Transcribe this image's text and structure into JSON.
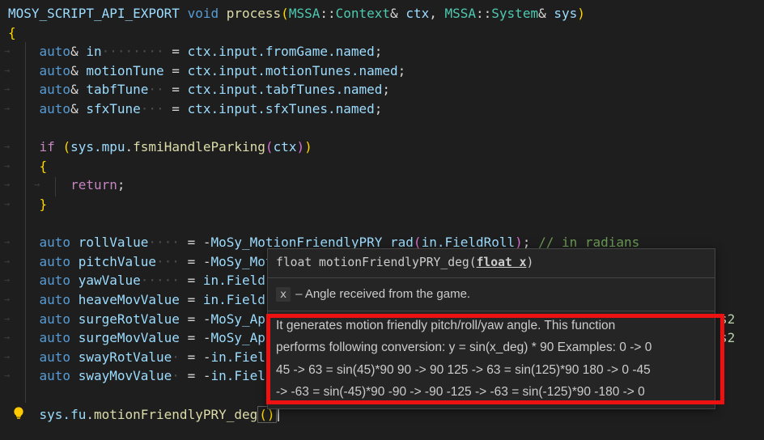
{
  "colors": {
    "editor_bg": "#1e1e1e",
    "keyword_blue": "#569cd6",
    "control_purple": "#c586c0",
    "variable_blue": "#9cdcfe",
    "function_yellow": "#dcdcaa",
    "type_teal": "#4ec9b0",
    "comment_green": "#6a9955",
    "bracket_gold": "#ffd700",
    "bracket_pink": "#da70d6",
    "annotation_red": "#ee1111",
    "lightbulb_yellow": "#ffcb00"
  },
  "editor": {
    "lines": [
      {
        "tokens": [
          [
            "v",
            "MOSY_SCRIPT_API_EXPORT"
          ],
          [
            "d",
            " "
          ],
          [
            "k",
            "void"
          ],
          [
            "d",
            " "
          ],
          [
            "f",
            "process"
          ],
          [
            "g",
            "("
          ],
          [
            "t",
            "MSSA"
          ],
          [
            "d",
            "::"
          ],
          [
            "t",
            "Context"
          ],
          [
            "d",
            "& "
          ],
          [
            "v",
            "ctx"
          ],
          [
            "d",
            ", "
          ],
          [
            "t",
            "MSSA"
          ],
          [
            "d",
            "::"
          ],
          [
            "t",
            "System"
          ],
          [
            "d",
            "& "
          ],
          [
            "v",
            "sys"
          ],
          [
            "g",
            ")"
          ]
        ]
      },
      {
        "tokens": [
          [
            "g",
            "{"
          ]
        ]
      },
      {
        "arrow": true,
        "tokens": [
          [
            "d",
            "    "
          ],
          [
            "k",
            "auto"
          ],
          [
            "d",
            "& "
          ],
          [
            "v",
            "in"
          ],
          [
            "w",
            "········"
          ],
          [
            "d",
            " = "
          ],
          [
            "v",
            "ctx.input.fromGame.named"
          ],
          [
            "d",
            ";"
          ]
        ]
      },
      {
        "arrow": true,
        "tokens": [
          [
            "d",
            "    "
          ],
          [
            "k",
            "auto"
          ],
          [
            "d",
            "& "
          ],
          [
            "v",
            "motionTune"
          ],
          [
            "d",
            " = "
          ],
          [
            "v",
            "ctx.input.motionTunes.named"
          ],
          [
            "d",
            ";"
          ]
        ]
      },
      {
        "arrow": true,
        "tokens": [
          [
            "d",
            "    "
          ],
          [
            "k",
            "auto"
          ],
          [
            "d",
            "& "
          ],
          [
            "v",
            "tabfTune"
          ],
          [
            "w",
            "··"
          ],
          [
            "d",
            " = "
          ],
          [
            "v",
            "ctx.input.tabfTunes.named"
          ],
          [
            "d",
            ";"
          ]
        ]
      },
      {
        "arrow": true,
        "tokens": [
          [
            "d",
            "    "
          ],
          [
            "k",
            "auto"
          ],
          [
            "d",
            "& "
          ],
          [
            "v",
            "sfxTune"
          ],
          [
            "w",
            "···"
          ],
          [
            "d",
            " = "
          ],
          [
            "v",
            "ctx.input.sfxTunes.named"
          ],
          [
            "d",
            ";"
          ]
        ]
      },
      {
        "tokens": []
      },
      {
        "arrow": true,
        "tokens": [
          [
            "d",
            "    "
          ],
          [
            "c",
            "if"
          ],
          [
            "d",
            " "
          ],
          [
            "g",
            "("
          ],
          [
            "v",
            "sys.mpu"
          ],
          [
            "d",
            "."
          ],
          [
            "f",
            "fsmiHandleParking"
          ],
          [
            "p",
            "("
          ],
          [
            "v",
            "ctx"
          ],
          [
            "p",
            ")"
          ],
          [
            "g",
            ")"
          ]
        ]
      },
      {
        "arrow": true,
        "tokens": [
          [
            "d",
            "    "
          ],
          [
            "g",
            "{"
          ]
        ]
      },
      {
        "arrow": true,
        "arrow2": true,
        "tokens": [
          [
            "d",
            "        "
          ],
          [
            "c",
            "return"
          ],
          [
            "d",
            ";"
          ]
        ]
      },
      {
        "arrow": true,
        "tokens": [
          [
            "d",
            "    "
          ],
          [
            "g",
            "}"
          ]
        ]
      },
      {
        "tokens": []
      },
      {
        "arrow": true,
        "tokens": [
          [
            "d",
            "    "
          ],
          [
            "k",
            "auto"
          ],
          [
            "d",
            " "
          ],
          [
            "v",
            "rollValue"
          ],
          [
            "w",
            "····"
          ],
          [
            "d",
            " = -"
          ],
          [
            "v",
            "MoSy_MotionFriendlyPRY_rad"
          ],
          [
            "p",
            "("
          ],
          [
            "v",
            "in.FieldRoll"
          ],
          [
            "p",
            ")"
          ],
          [
            "d",
            "; "
          ],
          [
            "m",
            "// in radians"
          ]
        ]
      },
      {
        "arrow": true,
        "tokens": [
          [
            "d",
            "    "
          ],
          [
            "k",
            "auto"
          ],
          [
            "d",
            " "
          ],
          [
            "v",
            "pitchValue"
          ],
          [
            "w",
            "···"
          ],
          [
            "d",
            " = -"
          ],
          [
            "v",
            "MoSy_Mot"
          ]
        ]
      },
      {
        "arrow": true,
        "tokens": [
          [
            "d",
            "    "
          ],
          [
            "k",
            "auto"
          ],
          [
            "d",
            " "
          ],
          [
            "v",
            "yawValue"
          ],
          [
            "w",
            "·····"
          ],
          [
            "d",
            " = "
          ],
          [
            "v",
            "in.Field"
          ]
        ]
      },
      {
        "arrow": true,
        "tokens": [
          [
            "d",
            "    "
          ],
          [
            "k",
            "auto"
          ],
          [
            "d",
            " "
          ],
          [
            "v",
            "heaveMovValue"
          ],
          [
            "d",
            " = "
          ],
          [
            "v",
            "in.Field"
          ]
        ]
      },
      {
        "arrow": true,
        "tail": "s2",
        "tokens": [
          [
            "d",
            "    "
          ],
          [
            "k",
            "auto"
          ],
          [
            "d",
            " "
          ],
          [
            "v",
            "surgeRotValue"
          ],
          [
            "d",
            " = -"
          ],
          [
            "v",
            "MoSy_Ap"
          ]
        ]
      },
      {
        "arrow": true,
        "tail": "s2",
        "tokens": [
          [
            "d",
            "    "
          ],
          [
            "k",
            "auto"
          ],
          [
            "d",
            " "
          ],
          [
            "v",
            "surgeMovValue"
          ],
          [
            "d",
            " = -"
          ],
          [
            "v",
            "MoSy_Ap"
          ]
        ]
      },
      {
        "arrow": true,
        "tokens": [
          [
            "d",
            "    "
          ],
          [
            "k",
            "auto"
          ],
          [
            "d",
            " "
          ],
          [
            "v",
            "swayRotValue"
          ],
          [
            "w",
            "·"
          ],
          [
            "d",
            " = -"
          ],
          [
            "v",
            "in.Fiel"
          ]
        ]
      },
      {
        "arrow": true,
        "tokens": [
          [
            "d",
            "    "
          ],
          [
            "k",
            "auto"
          ],
          [
            "d",
            " "
          ],
          [
            "v",
            "swayMovValue"
          ],
          [
            "w",
            "·"
          ],
          [
            "d",
            " = -"
          ],
          [
            "v",
            "in.Fiel"
          ]
        ]
      },
      {
        "tokens": []
      },
      {
        "bulb": true,
        "bracket": "()",
        "cursor": true,
        "tokens": [
          [
            "d",
            "    "
          ],
          [
            "v",
            "sys.fu"
          ],
          [
            "d",
            "."
          ],
          [
            "f",
            "motionFriendlyPRY_deg"
          ]
        ]
      }
    ]
  },
  "tooltip": {
    "signature_pre": "float motionFriendlyPRY_deg(",
    "signature_active_param": "float x",
    "signature_post": ")",
    "param_name": "x",
    "param_desc": "– Angle received from the game.",
    "doc_lines": [
      "It generates motion friendly pitch/roll/yaw angle. This function",
      "performs following conversion: y = sin(x_deg) * 90 Examples: 0 -> 0",
      "45 -> 63 = sin(45)*90 90 -> 90 125 -> 63 = sin(125)*90 180 -> 0 -45",
      "-> -63 = sin(-45)*90 -90 -> -90 -125 -> -63 = sin(-125)*90 -180 -> 0"
    ]
  }
}
